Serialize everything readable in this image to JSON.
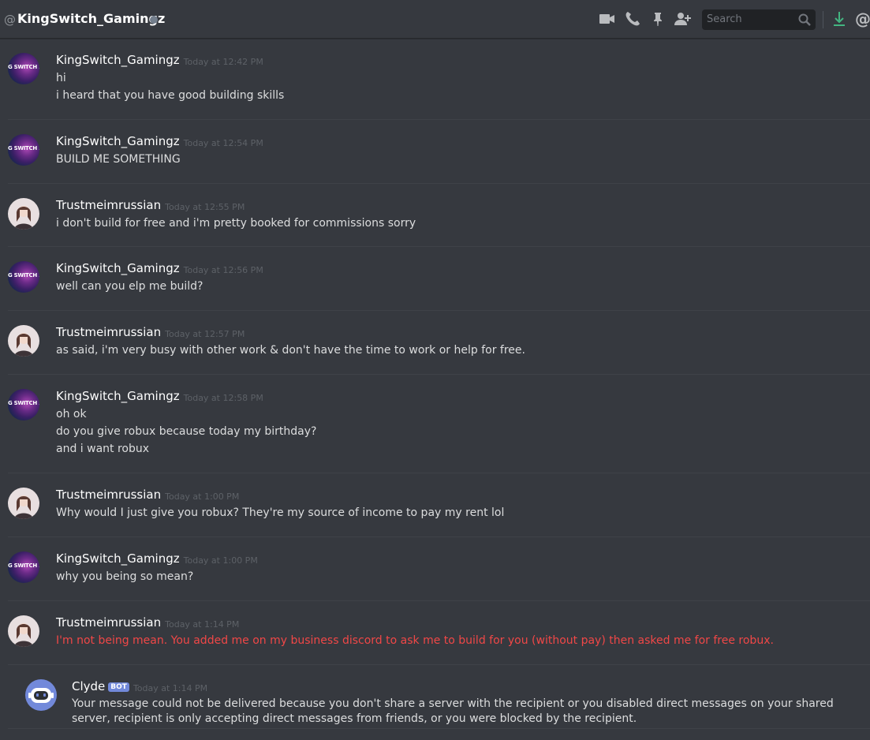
{
  "header": {
    "at_symbol": "@",
    "dm_name": "KingSwitch_Gamingz",
    "search_placeholder": "Search",
    "status_color": "#747f8d",
    "icons": [
      "video-call-icon",
      "voice-call-icon",
      "pin-icon",
      "add-friend-icon",
      "search-icon",
      "download-icon",
      "mentions-icon"
    ],
    "mentions_symbol": "@"
  },
  "avatar_text": "G SWITCH 1",
  "messages": [
    {
      "author": "KingSwitch_Gamingz",
      "timestamp": "Today at 12:42 PM",
      "lines": [
        "hi",
        "i heard that you have good building skills"
      ]
    },
    {
      "author": "KingSwitch_Gamingz",
      "timestamp": "Today at 12:54 PM",
      "lines": [
        "BUILD ME SOMETHING"
      ]
    },
    {
      "author": "Trustmeimrussian",
      "timestamp": "Today at 12:55 PM",
      "lines": [
        "i don't build for free and i'm pretty booked for commissions sorry"
      ]
    },
    {
      "author": "KingSwitch_Gamingz",
      "timestamp": "Today at 12:56 PM",
      "lines": [
        "well can you elp me build?"
      ]
    },
    {
      "author": "Trustmeimrussian",
      "timestamp": "Today at 12:57 PM",
      "lines": [
        "as said, i'm very busy with other work & don't have the time to work or help for free."
      ]
    },
    {
      "author": "KingSwitch_Gamingz",
      "timestamp": "Today at 12:58 PM",
      "lines": [
        "oh ok",
        "do you give robux because today my birthday?",
        "and i want robux"
      ]
    },
    {
      "author": "Trustmeimrussian",
      "timestamp": "Today at 1:00 PM",
      "lines": [
        "Why would I just give you robux? They're my source of income to pay my rent lol"
      ]
    },
    {
      "author": "KingSwitch_Gamingz",
      "timestamp": "Today at 1:00 PM",
      "lines": [
        "why you being so mean?"
      ]
    },
    {
      "author": "Trustmeimrussian",
      "timestamp": "Today at 1:14 PM",
      "lines": [
        "I'm not being mean. You added me on my business discord to ask me to build for you (without pay) then asked me for free robux."
      ],
      "failed": true,
      "failed_color": "#f04747"
    }
  ],
  "clyde": {
    "author": "Clyde",
    "bot_tag": "BOT",
    "timestamp": "Today at 1:14 PM",
    "text": "Your message could not be delivered because you don't share a server with the recipient or you disabled direct messages on your shared server, recipient is only accepting direct messages from friends, or you were blocked by the recipient."
  },
  "colors": {
    "background": "#36393f",
    "username": "#ffffff",
    "message_text": "#dcddde",
    "timestamp": "#5d6167",
    "bot_tag": "#7289da",
    "download_icon": "#43b581"
  }
}
